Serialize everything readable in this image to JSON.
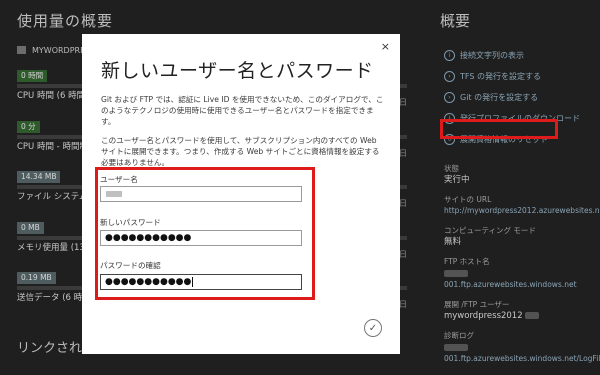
{
  "usage": {
    "title": "使用量の概要",
    "site_name": "MYWORDPRESS",
    "metrics": [
      {
        "value": "0 時間",
        "label": "CPU 時間 (6 時間",
        "tone": "green"
      },
      {
        "value": "0 分",
        "label": "CPU 時間 - 時間制",
        "tone": "green"
      },
      {
        "value": "14.34 MB",
        "label": "ファイル システム",
        "tone": "gray"
      },
      {
        "value": "0 MB",
        "label": "メモリ使用量 (13 分",
        "tone": "gray"
      },
      {
        "value": "0.19 MB",
        "label": "送信データ (6 時間",
        "tone": "gray"
      }
    ],
    "edge_marks": [
      "日",
      "日",
      "日",
      "日",
      "日"
    ],
    "links_title": "リンクされた"
  },
  "overview": {
    "title": "概要",
    "actions": [
      {
        "label": "接続文字列の表示",
        "icon": "info-icon"
      },
      {
        "label": "TFS の発行を設定する",
        "icon": "tfs-icon"
      },
      {
        "label": "Git の発行を設定する",
        "icon": "git-icon"
      },
      {
        "label": "発行プロファイルのダウンロード",
        "icon": "download-icon"
      },
      {
        "label": "展開資格情報のリセット",
        "icon": "reset-icon"
      }
    ],
    "props": [
      {
        "label": "状態",
        "value": "実行中",
        "blue": false
      },
      {
        "label": "サイトの URL",
        "value": "http://mywordpress2012.azurewebsites.net",
        "blue": true
      },
      {
        "label": "コンピューティング モード",
        "value": "無料",
        "blue": false
      },
      {
        "label": "FTP ホスト名",
        "value": "001.ftp.azurewebsites.windows.net",
        "blue": true
      },
      {
        "label": "展開 /FTP ユーザー",
        "value": "mywordpress2012",
        "blue": false
      },
      {
        "label": "診断ログ",
        "value": "001.ftp.azurewebsites.windows.net/LogFiles",
        "blue": true
      }
    ],
    "accent_red": "#dd1b1b"
  },
  "dialog": {
    "title": "新しいユーザー名とパスワード",
    "close": "×",
    "para1": "Git および FTP では、認証に Live ID を使用できないため、このダイアログで、このようなテクノロジの使用時に使用できるユーザー名とパスワードを指定できます。",
    "para2": "このユーザー名とパスワードを使用して、サブスクリプション内のすべての Web サイトに展開できます。つまり、作成する Web サイトごとに資格情報を設定する必要はありません。",
    "username_label": "ユーザー名",
    "password_label": "新しいパスワード",
    "confirm_label": "パスワードの確認",
    "password_value": "●●●●●●●●●●●",
    "confirm_value": "●●●●●●●●●●●",
    "ok": "✓"
  }
}
